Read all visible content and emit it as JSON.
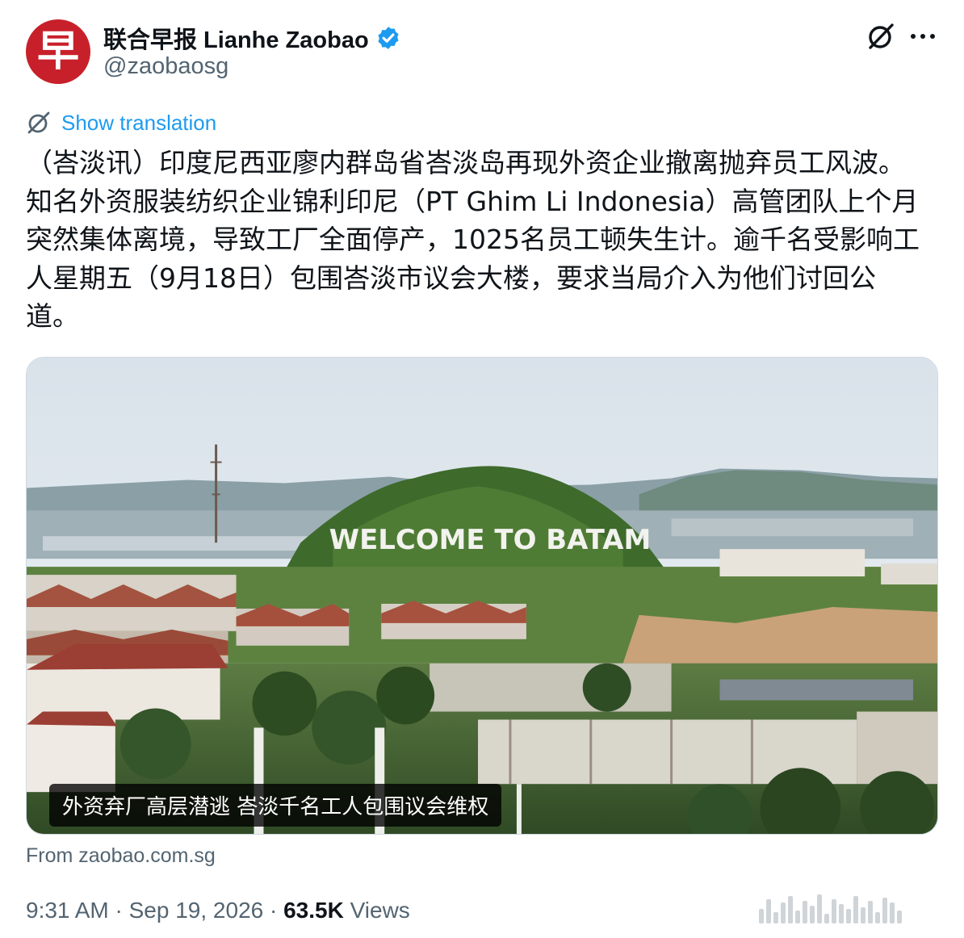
{
  "account": {
    "avatar_glyph": "早",
    "display_name": "联合早报 Lianhe Zaobao",
    "handle": "@zaobaosg",
    "verified_color": "#1d9bf0"
  },
  "actions": {
    "grok_icon": "grok-slash-circle-icon",
    "more_icon": "more-horizontal-icon",
    "more_glyph": "···"
  },
  "translate": {
    "label": "Show translation"
  },
  "tweet": {
    "lines": [
      "（峇淡讯）印度尼西亚廖内群岛省峇淡岛再现外资企业撤离抛弃员工风波。",
      "知名外资服装纺织企业锦利印尼（PT Ghim Li Indonesia）高管团队上个月",
      "突然集体离境，导致工厂全面停产，1025名员工顿失生计。逾千名受影响工",
      "人星期五（9月18日）包围峇淡市议会大楼，要求当局介入为他们讨回公",
      "道。"
    ]
  },
  "media": {
    "sign_text": "WELCOME TO BATAM",
    "caption": "外资弃厂高层潜逃 峇淡千名工人包围议会维权"
  },
  "source": {
    "text": "From zaobao.com.sg"
  },
  "meta": {
    "time": "9:31 AM",
    "separator": " · ",
    "date": "Sep 19, 2026",
    "views_count": "63.5K",
    "views_label": "Views"
  },
  "colors": {
    "link": "#1d9bf0",
    "secondary_text": "#536471",
    "avatar_red": "#c8202a"
  }
}
